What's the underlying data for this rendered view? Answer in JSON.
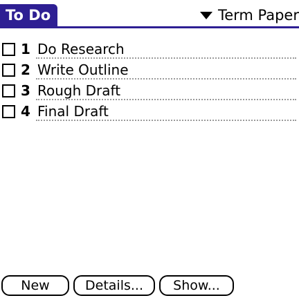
{
  "header": {
    "title": "To Do",
    "category": "Term Paper",
    "title_color": "#2e1f93"
  },
  "todos": [
    {
      "priority": "1",
      "description": "Do Research",
      "checked": false
    },
    {
      "priority": "2",
      "description": "Write Outline",
      "checked": false
    },
    {
      "priority": "3",
      "description": "Rough Draft",
      "checked": false
    },
    {
      "priority": "4",
      "description": "Final Draft",
      "checked": false
    }
  ],
  "buttons": {
    "new_label": "New",
    "details_label": "Details...",
    "show_label": "Show..."
  },
  "icons": {
    "category_dropdown": "triangle-down-icon"
  }
}
